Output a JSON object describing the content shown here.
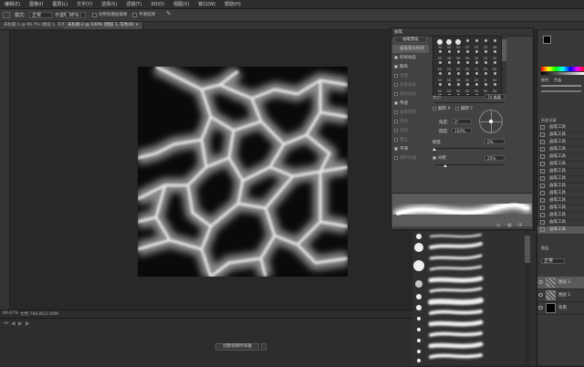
{
  "menu": {
    "items": [
      "编辑(E)",
      "图像(I)",
      "图层(L)",
      "文字(Y)",
      "选择(S)",
      "滤镜(T)",
      "3D(D)",
      "视图(V)",
      "窗口(W)",
      "帮助(H)"
    ]
  },
  "options": {
    "mode_label": "模式:",
    "mode_value": "正常",
    "opacity_label": "不透明度:",
    "opacity_value": "38%",
    "flow_label": "流量:",
    "flow_value": "100%",
    "check1_label": "对所有图层取样",
    "check2_label": "平滑选项"
  },
  "tabs": {
    "tab1": "未标题-1 @ 66.7% (图层 1, 灰色/8)",
    "tab2": "未标题-2 @ 100% (图层 1, 灰色/8)"
  },
  "status": {
    "zoom": "66.67%",
    "doc": "文档:768.0K/2.00M"
  },
  "timeline": {
    "button": "创建视频时间轴"
  },
  "brush_panel": {
    "tab_label": "画笔",
    "preset_button": "画笔预设",
    "sections": [
      {
        "label": "画笔笔尖形状",
        "checked": null,
        "selected": true
      },
      {
        "label": "形状动态",
        "checked": true,
        "selected": false
      },
      {
        "label": "散布",
        "checked": true,
        "selected": false
      },
      {
        "label": "纹理",
        "checked": false,
        "selected": false
      },
      {
        "label": "双重画笔",
        "checked": false,
        "selected": false
      },
      {
        "label": "颜色动态",
        "checked": false,
        "selected": false
      },
      {
        "label": "传递",
        "checked": true,
        "selected": false
      },
      {
        "label": "画笔笔势",
        "checked": false,
        "selected": false
      },
      {
        "label": "杂色",
        "checked": false,
        "selected": false
      },
      {
        "label": "湿边",
        "checked": false,
        "selected": false
      },
      {
        "label": "建立",
        "checked": false,
        "selected": false
      },
      {
        "label": "平滑",
        "checked": true,
        "selected": false
      },
      {
        "label": "保护纹理",
        "checked": false,
        "selected": false
      }
    ],
    "tip_sizes": [
      "30",
      "30",
      "30",
      "25",
      "25",
      "25",
      "36",
      "25",
      "36",
      "36",
      "36",
      "32",
      "25",
      "25",
      "50",
      "25",
      "25",
      "50",
      "71",
      "25",
      "50",
      "50",
      "50",
      "36",
      "30",
      "20",
      "9",
      "50",
      "50",
      "50",
      "50",
      "50",
      "50",
      "50",
      "50",
      "50",
      "50",
      "50",
      "50",
      "50"
    ],
    "size_label": "大小",
    "size_value": "74 像素",
    "flip_x": "翻转 X",
    "flip_y": "翻转 Y",
    "angle_label": "角度:",
    "angle_value": "0°",
    "roundness_label": "圆度:",
    "roundness_value": "100%",
    "hardness_label": "硬度",
    "hardness_value": "0%",
    "spacing_label": "间距",
    "spacing_value": "25%"
  },
  "right_panel": {
    "tab1": "颜色",
    "tab2": "色板",
    "tab3": "历史记录",
    "history": [
      "画笔工具",
      "画笔工具",
      "画笔工具",
      "画笔工具",
      "画笔工具",
      "画笔工具",
      "画笔工具",
      "画笔工具",
      "画笔工具",
      "画笔工具",
      "画笔工具",
      "画笔工具",
      "画笔工具",
      "画笔工具",
      "画笔工具"
    ],
    "layers_tab": "图层",
    "layer_mode": "正常",
    "layers": [
      {
        "name": "图层 1",
        "type": "cells"
      },
      {
        "name": "图层 1",
        "type": "cells"
      },
      {
        "name": "背景",
        "type": "black"
      }
    ]
  },
  "colors": {
    "accent": "#5a5a5a",
    "canvas_bg": "#000000",
    "brush_stroke": "#ffffff"
  }
}
